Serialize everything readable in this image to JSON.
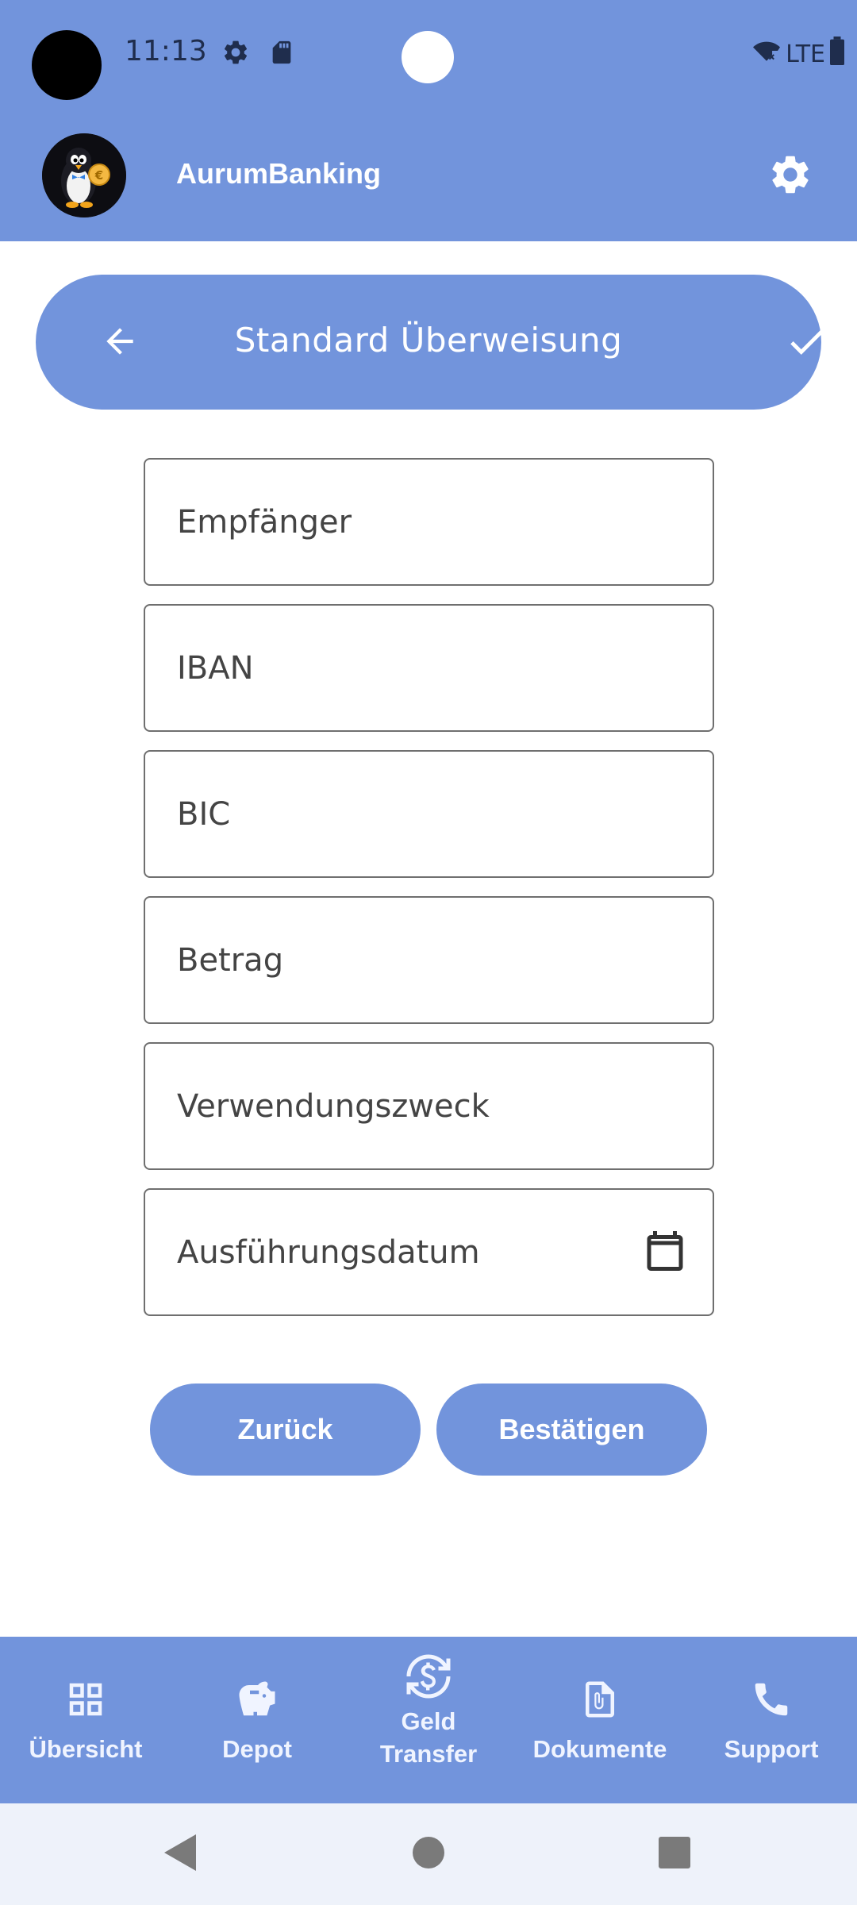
{
  "status_bar": {
    "time": "11:13",
    "network": "LTE"
  },
  "app_bar": {
    "title": "AurumBanking",
    "settings_icon": "gear-icon"
  },
  "screen_header": {
    "title": "Standard Überweisung",
    "back_icon": "arrow-left-icon",
    "confirm_icon": "check-icon"
  },
  "form": {
    "fields": [
      {
        "id": "recipient",
        "placeholder": "Empfänger",
        "value": ""
      },
      {
        "id": "iban",
        "placeholder": "IBAN",
        "value": ""
      },
      {
        "id": "bic",
        "placeholder": "BIC",
        "value": ""
      },
      {
        "id": "amount",
        "placeholder": "Betrag",
        "value": ""
      },
      {
        "id": "purpose",
        "placeholder": "Verwendungszweck",
        "value": ""
      },
      {
        "id": "execution_date",
        "placeholder": "Ausführungsdatum",
        "value": "",
        "icon": "calendar-icon"
      }
    ]
  },
  "buttons": {
    "back_label": "Zurück",
    "confirm_label": "Bestätigen"
  },
  "bottom_nav": {
    "items": [
      {
        "label": "Übersicht",
        "icon": "grid-icon"
      },
      {
        "label": "Depot",
        "icon": "piggy-bank-icon"
      },
      {
        "label": "Geld\nTransfer",
        "icon": "currency-exchange-icon"
      },
      {
        "label": "Dokumente",
        "icon": "paperclip-document-icon"
      },
      {
        "label": "Support",
        "icon": "phone-icon"
      }
    ]
  },
  "colors": {
    "primary": "#7294DC",
    "on_primary": "#FFFFFF",
    "field_border": "#6F6F6F",
    "system_nav_bg": "#EEF2FA"
  }
}
